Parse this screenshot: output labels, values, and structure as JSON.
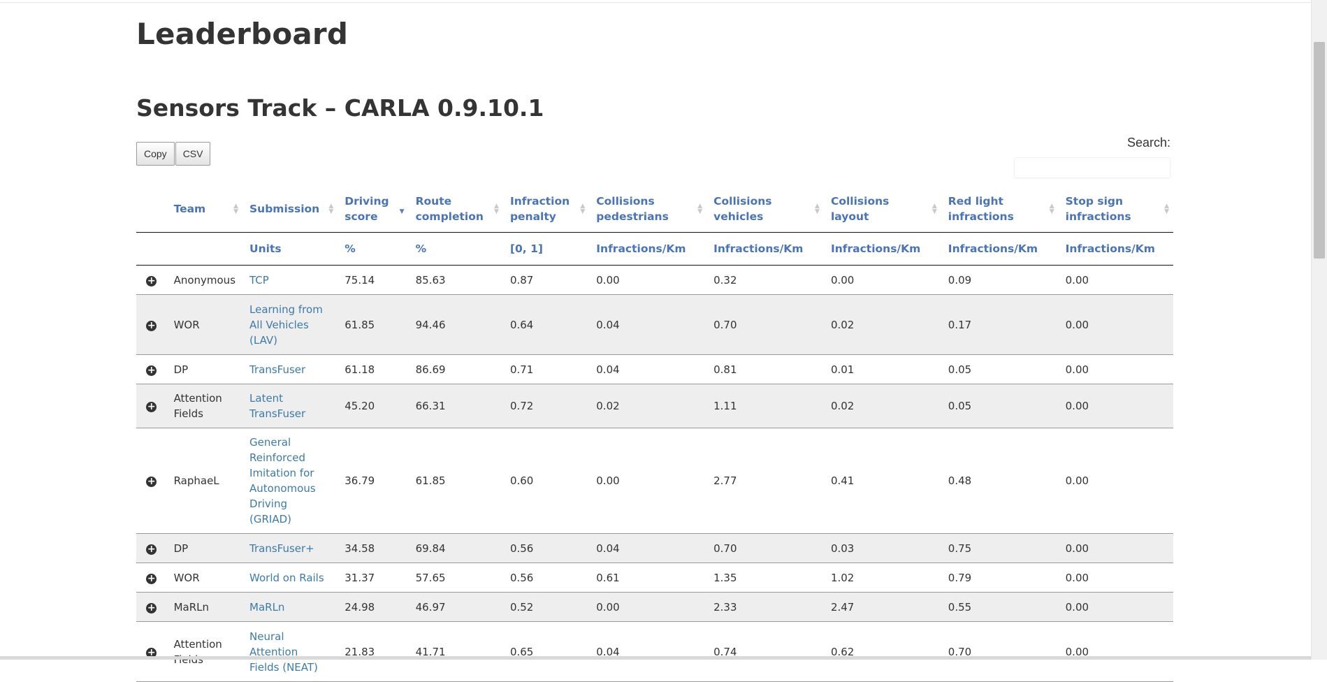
{
  "page": {
    "title": "Leaderboard",
    "track_title": "Sensors Track – CARLA 0.9.10.1"
  },
  "buttons": {
    "copy": "Copy",
    "csv": "CSV"
  },
  "search": {
    "label": "Search:",
    "placeholder": ""
  },
  "columns": [
    {
      "label": "Team"
    },
    {
      "label": "Submission"
    },
    {
      "label": "Driving score",
      "sorted": "desc"
    },
    {
      "label": "Route completion"
    },
    {
      "label": "Infraction penalty"
    },
    {
      "label": "Collisions pedestrians"
    },
    {
      "label": "Collisions vehicles"
    },
    {
      "label": "Collisions layout"
    },
    {
      "label": "Red light infractions"
    },
    {
      "label": "Stop sign infractions"
    }
  ],
  "units": [
    "",
    "Units",
    "%",
    "%",
    "[0, 1]",
    "Infractions/Km",
    "Infractions/Km",
    "Infractions/Km",
    "Infractions/Km",
    "Infractions/Km"
  ],
  "rows": [
    {
      "team": "Anonymous",
      "submission": "TCP",
      "driving": "75.14",
      "route": "85.63",
      "penalty": "0.87",
      "ped": "0.00",
      "veh": "0.32",
      "layout": "0.00",
      "red": "0.09",
      "stop": "0.00"
    },
    {
      "team": "WOR",
      "submission": "Learning from All Vehicles (LAV)",
      "driving": "61.85",
      "route": "94.46",
      "penalty": "0.64",
      "ped": "0.04",
      "veh": "0.70",
      "layout": "0.02",
      "red": "0.17",
      "stop": "0.00"
    },
    {
      "team": "DP",
      "submission": "TransFuser",
      "driving": "61.18",
      "route": "86.69",
      "penalty": "0.71",
      "ped": "0.04",
      "veh": "0.81",
      "layout": "0.01",
      "red": "0.05",
      "stop": "0.00"
    },
    {
      "team": "Attention Fields",
      "submission": "Latent TransFuser",
      "driving": "45.20",
      "route": "66.31",
      "penalty": "0.72",
      "ped": "0.02",
      "veh": "1.11",
      "layout": "0.02",
      "red": "0.05",
      "stop": "0.00"
    },
    {
      "team": "RaphaeL",
      "submission": "General Reinforced Imitation for Autonomous Driving (GRIAD)",
      "driving": "36.79",
      "route": "61.85",
      "penalty": "0.60",
      "ped": "0.00",
      "veh": "2.77",
      "layout": "0.41",
      "red": "0.48",
      "stop": "0.00"
    },
    {
      "team": "DP",
      "submission": "TransFuser+",
      "driving": "34.58",
      "route": "69.84",
      "penalty": "0.56",
      "ped": "0.04",
      "veh": "0.70",
      "layout": "0.03",
      "red": "0.75",
      "stop": "0.00"
    },
    {
      "team": "WOR",
      "submission": "World on Rails",
      "driving": "31.37",
      "route": "57.65",
      "penalty": "0.56",
      "ped": "0.61",
      "veh": "1.35",
      "layout": "1.02",
      "red": "0.79",
      "stop": "0.00"
    },
    {
      "team": "MaRLn",
      "submission": "MaRLn",
      "driving": "24.98",
      "route": "46.97",
      "penalty": "0.52",
      "ped": "0.00",
      "veh": "2.33",
      "layout": "2.47",
      "red": "0.55",
      "stop": "0.00"
    },
    {
      "team": "Attention Fields",
      "submission": "Neural Attention Fields (NEAT)",
      "driving": "21.83",
      "route": "41.71",
      "penalty": "0.65",
      "ped": "0.04",
      "veh": "0.74",
      "layout": "0.62",
      "red": "0.70",
      "stop": "0.00"
    }
  ]
}
